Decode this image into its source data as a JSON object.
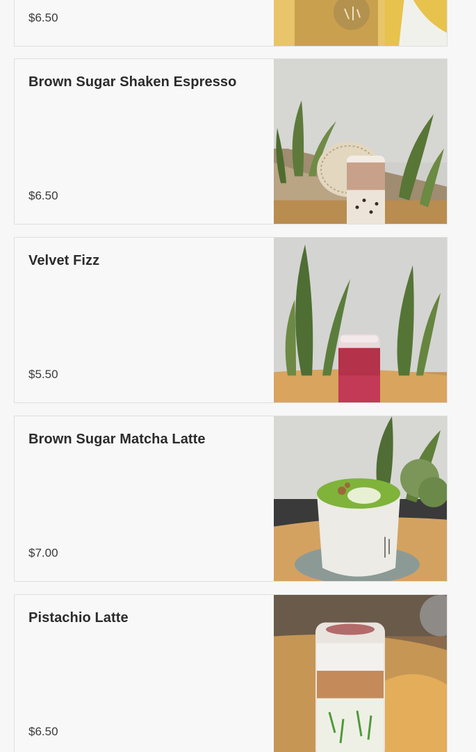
{
  "menu": {
    "items": [
      {
        "name": "",
        "price": "$6.50"
      },
      {
        "name": "Brown Sugar Shaken Espresso",
        "price": "$6.50"
      },
      {
        "name": "Velvet Fizz",
        "price": "$5.50"
      },
      {
        "name": "Brown Sugar Matcha Latte",
        "price": "$7.00"
      },
      {
        "name": "Pistachio Latte",
        "price": "$6.50"
      }
    ]
  },
  "colors": {
    "card_background": "#f8f8f8",
    "card_border": "#dedede",
    "title_text": "#2b2b2b",
    "price_text": "#3a3a3a",
    "page_background": "#f7f7f7"
  }
}
